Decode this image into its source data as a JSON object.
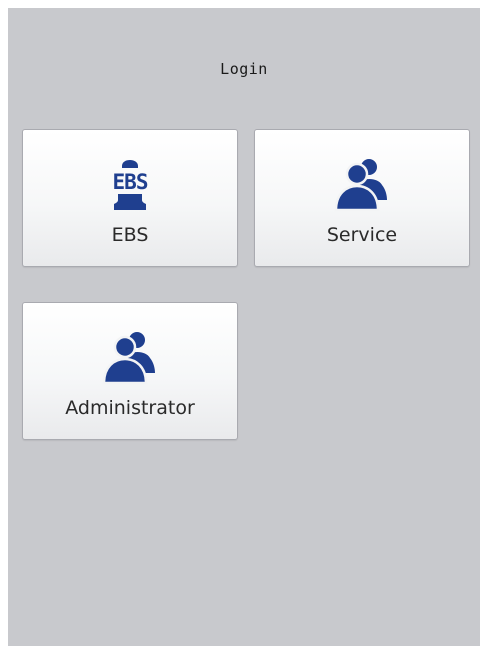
{
  "header": {
    "title": "Login"
  },
  "tiles": [
    {
      "label": "EBS",
      "icon": "ebs-logo-icon",
      "icon_text": "EBS"
    },
    {
      "label": "Service",
      "icon": "users-icon"
    },
    {
      "label": "Administrator",
      "icon": "users-icon"
    }
  ],
  "colors": {
    "icon": "#1f3f8f",
    "background": "#c8c9cd",
    "tile": "#f4f5f6"
  }
}
